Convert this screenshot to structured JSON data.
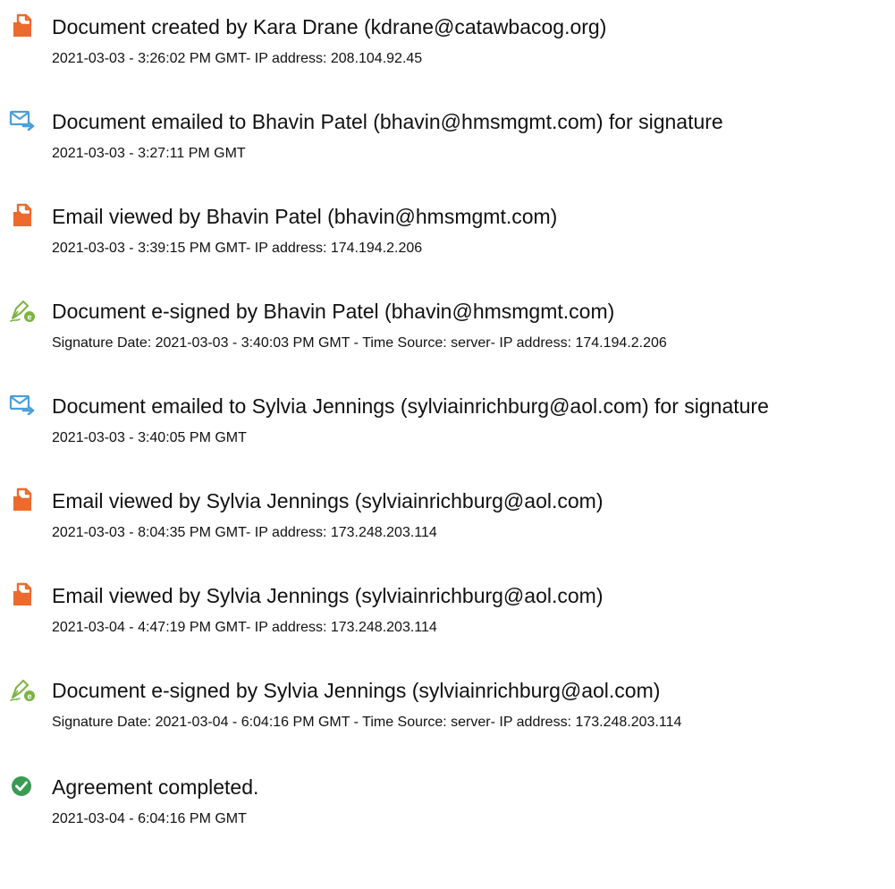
{
  "colors": {
    "doc_icon": "#ee6a2c",
    "mail_icon": "#4a9fd8",
    "sign_icon": "#7cb342",
    "check_icon": "#3a9b53"
  },
  "events": [
    {
      "icon": "document-icon",
      "title": "Document created by Kara Drane (kdrane@catawbacog.org)",
      "detail": "2021-03-03 - 3:26:02 PM GMT- IP address: 208.104.92.45"
    },
    {
      "icon": "email-sent-icon",
      "title": "Document emailed to Bhavin Patel (bhavin@hmsmgmt.com) for signature",
      "detail": "2021-03-03 - 3:27:11 PM GMT"
    },
    {
      "icon": "document-icon",
      "title": "Email viewed by Bhavin Patel (bhavin@hmsmgmt.com)",
      "detail": "2021-03-03 - 3:39:15 PM GMT- IP address: 174.194.2.206"
    },
    {
      "icon": "esign-pen-icon",
      "title": "Document e-signed by Bhavin Patel (bhavin@hmsmgmt.com)",
      "detail": "Signature Date: 2021-03-03 - 3:40:03 PM GMT - Time Source: server- IP address: 174.194.2.206"
    },
    {
      "icon": "email-sent-icon",
      "title": "Document emailed to Sylvia Jennings (sylviainrichburg@aol.com) for signature",
      "detail": "2021-03-03 - 3:40:05 PM GMT"
    },
    {
      "icon": "document-icon",
      "title": "Email viewed by Sylvia Jennings (sylviainrichburg@aol.com)",
      "detail": "2021-03-03 - 8:04:35 PM GMT- IP address: 173.248.203.114"
    },
    {
      "icon": "document-icon",
      "title": "Email viewed by Sylvia Jennings (sylviainrichburg@aol.com)",
      "detail": "2021-03-04 - 4:47:19 PM GMT- IP address: 173.248.203.114"
    },
    {
      "icon": "esign-pen-icon",
      "title": "Document e-signed by Sylvia Jennings (sylviainrichburg@aol.com)",
      "detail": "Signature Date: 2021-03-04 - 6:04:16 PM GMT - Time Source: server- IP address: 173.248.203.114"
    },
    {
      "icon": "check-circle-icon",
      "title": "Agreement completed.",
      "detail": "2021-03-04 - 6:04:16 PM GMT"
    }
  ]
}
